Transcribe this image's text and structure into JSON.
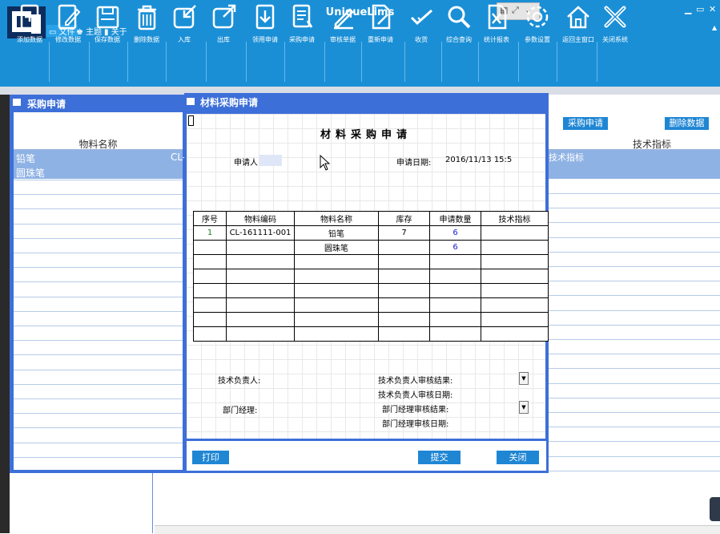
{
  "app": {
    "title": "UniqueLims"
  },
  "menu": {
    "file": "文件",
    "theme": "主题",
    "about": "关于"
  },
  "window_controls": {
    "minimize": "▁",
    "restore": "▭",
    "close": "✕"
  },
  "toolbar": [
    {
      "label": "添加数据",
      "icon": "add-doc-icon"
    },
    {
      "label": "修改数据",
      "icon": "edit-doc-icon"
    },
    {
      "label": "保存数据",
      "icon": "save-icon"
    },
    {
      "label": "删除数据",
      "icon": "trash-icon"
    },
    {
      "label": "入库",
      "icon": "stock-in-icon"
    },
    {
      "label": "出库",
      "icon": "stock-out-icon"
    },
    {
      "label": "领用申请",
      "icon": "download-doc-icon"
    },
    {
      "label": "采购申请",
      "icon": "list-doc-icon"
    },
    {
      "label": "审核单据",
      "icon": "pen-icon"
    },
    {
      "label": "重新申请",
      "icon": "redo-doc-icon"
    },
    {
      "label": "收货",
      "icon": "check-icon"
    },
    {
      "label": "综合查询",
      "icon": "search-icon"
    },
    {
      "label": "统计报表",
      "icon": "excel-icon"
    },
    {
      "label": "参数设置",
      "icon": "gear-icon"
    },
    {
      "label": "返回主窗口",
      "icon": "home-icon"
    },
    {
      "label": "关闭系统",
      "icon": "close-icon"
    }
  ],
  "bg_window": {
    "title": "采购申请",
    "column": "物料名称",
    "col2_fragment": "CL-",
    "rows": [
      "铅笔",
      "圆珠笔"
    ]
  },
  "bg_right": {
    "button_purchase": "采购申请",
    "button_delete": "删除数据",
    "column": "技术指标",
    "row_fragment": "技术指标"
  },
  "dialog": {
    "title": "材料采购申请",
    "form_title": "材料采购申请",
    "applicant_label": "申请人",
    "applicant_value": "",
    "date_label": "申请日期:",
    "date_value": "2016/11/13 15:5",
    "table_headers": [
      "序号",
      "物料编码",
      "物料名称",
      "库存",
      "申请数量",
      "技术指标"
    ],
    "table_rows": [
      [
        "1",
        "CL-161111-001",
        "铅笔",
        "7",
        "6",
        ""
      ],
      [
        "",
        "",
        "圆珠笔",
        "",
        "6",
        ""
      ],
      [
        "",
        "",
        "",
        "",
        "",
        ""
      ],
      [
        "",
        "",
        "",
        "",
        "",
        ""
      ],
      [
        "",
        "",
        "",
        "",
        "",
        ""
      ],
      [
        "",
        "",
        "",
        "",
        "",
        ""
      ],
      [
        "",
        "",
        "",
        "",
        "",
        ""
      ],
      [
        "",
        "",
        "",
        "",
        "",
        ""
      ]
    ],
    "tech_lead_label": "技术负责人:",
    "tech_review_result_label": "技术负责人审核结果:",
    "tech_review_date_label": "技术负责人审核日期:",
    "dept_manager_label": "部门经理:",
    "dept_review_result_label": "部门经理审核结果:",
    "dept_review_date_label": "部门经理审核日期:",
    "print_button": "打印",
    "submit_button": "提交",
    "close_button": "关闭"
  },
  "colors": {
    "titlebar": "#1a8fd6",
    "window_frame": "#3d6fd8",
    "button": "#1f86d4",
    "selection": "#8fb2e4"
  }
}
